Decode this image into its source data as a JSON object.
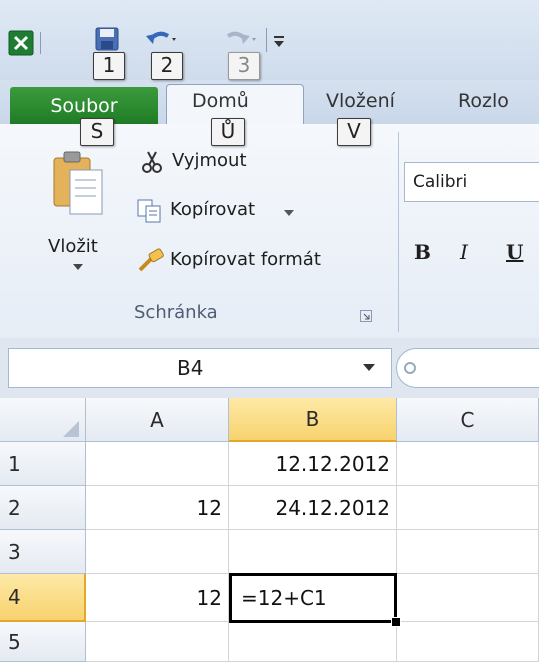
{
  "qat": {
    "keytips": [
      "1",
      "2",
      "3"
    ]
  },
  "tabs": {
    "file": "Soubor",
    "home": "Domů",
    "insert": "Vložení",
    "layout": "Rozlo",
    "keytips": {
      "file": "S",
      "home": "Ů",
      "insert": "V"
    }
  },
  "ribbon": {
    "paste_label": "Vložit",
    "cut_label": "Vyjmout",
    "copy_label": "Kopírovat",
    "format_painter_label": "Kopírovat formát",
    "clipboard_group": "Schránka",
    "font_name": "Calibri",
    "bold": "B",
    "italic": "I",
    "underline": "U"
  },
  "formula_bar": {
    "name_box": "B4"
  },
  "grid": {
    "columns": [
      "A",
      "B",
      "C"
    ],
    "rows": [
      "1",
      "2",
      "3",
      "4",
      "5"
    ],
    "cells": {
      "B1": "12.12.2012",
      "A2": "12",
      "B2": "24.12.2012",
      "A4": "12",
      "B4": "=12+C1"
    },
    "active_cell": "B4"
  },
  "colors": {
    "file_tab": "#1f7c26",
    "selected_header": "#f8d36e"
  }
}
